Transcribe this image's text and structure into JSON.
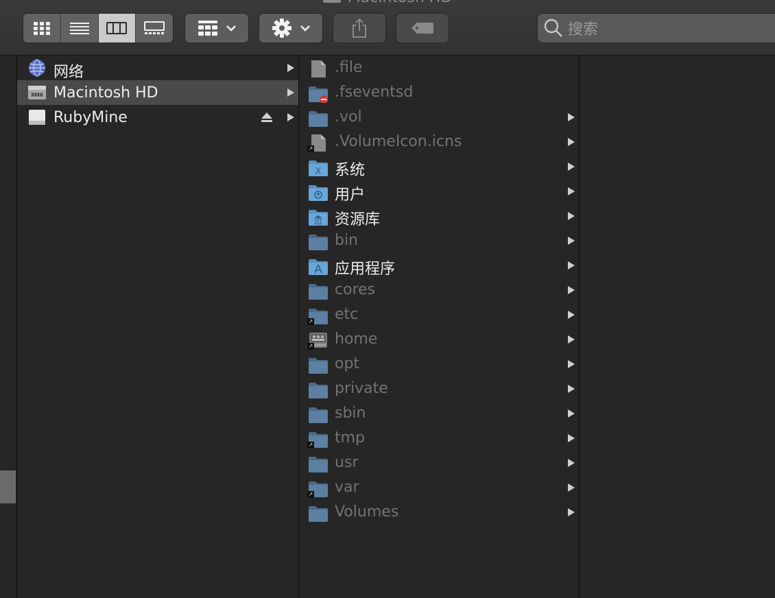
{
  "window": {
    "title": "Macintosh HD"
  },
  "toolbar": {
    "view_modes": [
      {
        "name": "icon-view",
        "active": false
      },
      {
        "name": "list-view",
        "active": false
      },
      {
        "name": "column-view",
        "active": true
      },
      {
        "name": "gallery-view",
        "active": false
      }
    ],
    "group_icon": "grid-group-icon",
    "action_icon": "gear-icon",
    "share_icon": "share-icon",
    "tag_icon": "tag-icon",
    "search": {
      "placeholder": "搜索"
    }
  },
  "sidebar_column": {
    "items": [
      {
        "label": "网络",
        "icon": "network-globe-icon",
        "selected": false,
        "eject": false
      },
      {
        "label": "Macintosh HD",
        "icon": "hard-drive-icon",
        "selected": true,
        "eject": false
      },
      {
        "label": "RubyMine",
        "icon": "external-drive-icon",
        "selected": false,
        "eject": true
      }
    ]
  },
  "content_column": {
    "items": [
      {
        "label": ".file",
        "icon": "document-icon",
        "hidden": true,
        "arrow": false,
        "alias": false
      },
      {
        "label": ".fseventsd",
        "icon": "restricted-folder-icon",
        "hidden": true,
        "arrow": false,
        "alias": false
      },
      {
        "label": ".vol",
        "icon": "folder-icon",
        "hidden": true,
        "arrow": true,
        "alias": false
      },
      {
        "label": ".VolumeIcon.icns",
        "icon": "document-icon",
        "hidden": true,
        "arrow": true,
        "alias": true
      },
      {
        "label": "系统",
        "icon": "system-folder-icon",
        "hidden": false,
        "arrow": true,
        "alias": false
      },
      {
        "label": "用户",
        "icon": "users-folder-icon",
        "hidden": false,
        "arrow": true,
        "alias": false
      },
      {
        "label": "资源库",
        "icon": "library-folder-icon",
        "hidden": false,
        "arrow": true,
        "alias": false
      },
      {
        "label": "bin",
        "icon": "folder-icon",
        "hidden": true,
        "arrow": true,
        "alias": false
      },
      {
        "label": "应用程序",
        "icon": "applications-folder-icon",
        "hidden": false,
        "arrow": true,
        "alias": false
      },
      {
        "label": "cores",
        "icon": "folder-icon",
        "hidden": true,
        "arrow": true,
        "alias": false
      },
      {
        "label": "etc",
        "icon": "folder-icon",
        "hidden": true,
        "arrow": true,
        "alias": true
      },
      {
        "label": "home",
        "icon": "server-icon",
        "hidden": true,
        "arrow": true,
        "alias": true
      },
      {
        "label": "opt",
        "icon": "folder-icon",
        "hidden": true,
        "arrow": true,
        "alias": false
      },
      {
        "label": "private",
        "icon": "folder-icon",
        "hidden": true,
        "arrow": true,
        "alias": false
      },
      {
        "label": "sbin",
        "icon": "folder-icon",
        "hidden": true,
        "arrow": true,
        "alias": false
      },
      {
        "label": "tmp",
        "icon": "folder-icon",
        "hidden": true,
        "arrow": true,
        "alias": true
      },
      {
        "label": "usr",
        "icon": "folder-icon",
        "hidden": true,
        "arrow": true,
        "alias": false
      },
      {
        "label": "var",
        "icon": "folder-icon",
        "hidden": true,
        "arrow": true,
        "alias": true
      },
      {
        "label": "Volumes",
        "icon": "folder-icon",
        "hidden": true,
        "arrow": true,
        "alias": false
      }
    ]
  },
  "colors": {
    "background": "#262626",
    "toolbar": "#363636",
    "selection": "#4a4a4a",
    "folder_blue": "#6aa6d8",
    "hidden_text": "#737373",
    "normal_text": "#ededed"
  }
}
